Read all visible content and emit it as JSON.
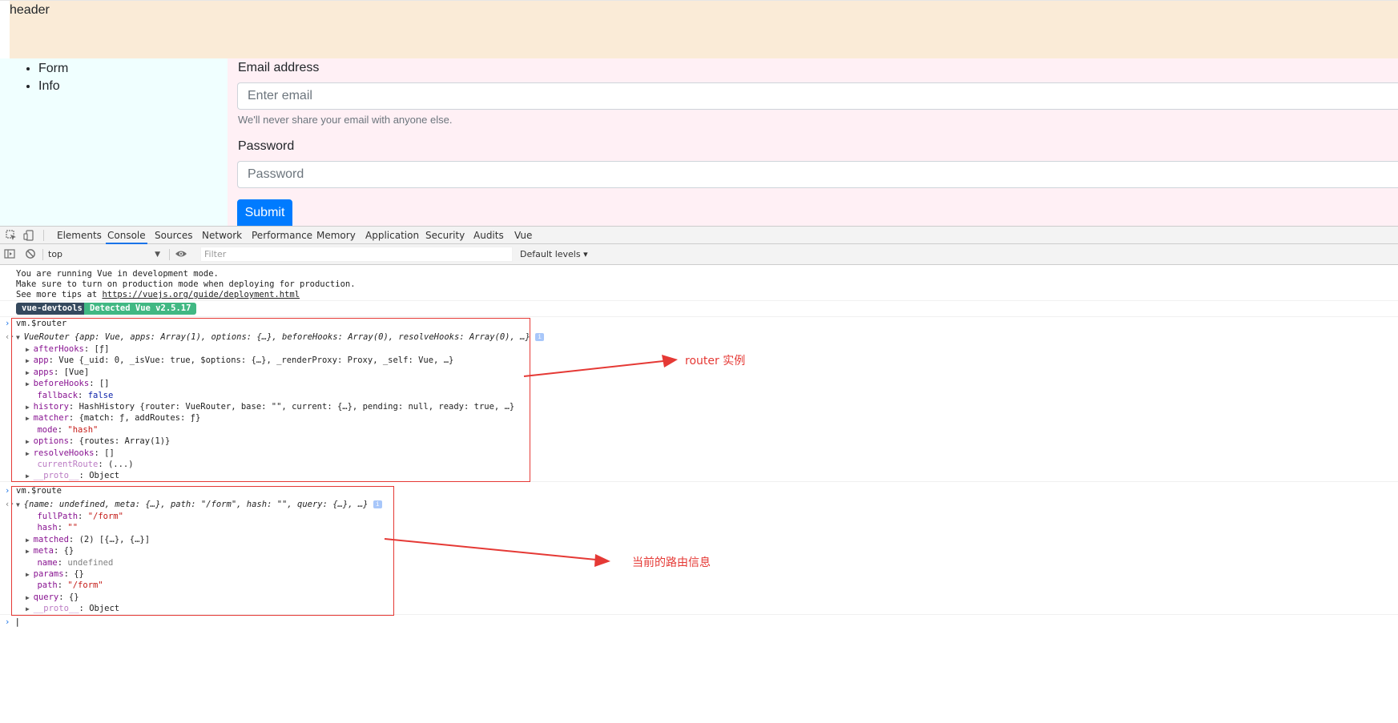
{
  "app": {
    "header_text": "header",
    "nav": [
      {
        "label": "Form"
      },
      {
        "label": "Info"
      }
    ],
    "form": {
      "email_label": "Email address",
      "email_placeholder": "Enter email",
      "email_help": "We'll never share your email with anyone else.",
      "password_label": "Password",
      "password_placeholder": "Password",
      "submit_label": "Submit"
    }
  },
  "devtools": {
    "tabs": [
      "Elements",
      "Console",
      "Sources",
      "Network",
      "Performance",
      "Memory",
      "Application",
      "Security",
      "Audits",
      "Vue"
    ],
    "active_tab": "Console",
    "context": "top",
    "filter_placeholder": "Filter",
    "levels_label": "Default levels ▾",
    "console": {
      "vue_dev_lines": [
        "You are running Vue in development mode.",
        "Make sure to turn on production mode when deploying for production."
      ],
      "tips_prefix": "See more tips at ",
      "tips_link": "https://vuejs.org/guide/deployment.html",
      "badge_left": "vue-devtools",
      "badge_right": "Detected Vue v2.5.17",
      "cmd_router": "vm.$router",
      "cmd_route": "vm.$route",
      "router_summary": "VueRouter {app: Vue, apps: Array(1), options: {…}, beforeHooks: Array(0), resolveHooks: Array(0), …}",
      "router_props": [
        {
          "key": "afterHooks",
          "value": "[ƒ]",
          "expandable": true
        },
        {
          "key": "app",
          "value": "Vue {_uid: 0, _isVue: true, $options: {…}, _renderProxy: Proxy, _self: Vue, …}",
          "expandable": true
        },
        {
          "key": "apps",
          "value": "[Vue]",
          "expandable": true
        },
        {
          "key": "beforeHooks",
          "value": "[]",
          "expandable": true
        },
        {
          "key": "fallback",
          "value": "false",
          "expandable": false
        },
        {
          "key": "history",
          "value": "HashHistory {router: VueRouter, base: \"\", current: {…}, pending: null, ready: true, …}",
          "expandable": true
        },
        {
          "key": "matcher",
          "value": "{match: ƒ, addRoutes: ƒ}",
          "expandable": true
        },
        {
          "key": "mode",
          "value": "\"hash\"",
          "expandable": false
        },
        {
          "key": "options",
          "value": "{routes: Array(1)}",
          "expandable": true
        },
        {
          "key": "resolveHooks",
          "value": "[]",
          "expandable": true
        },
        {
          "key": "currentRoute",
          "value": "(...)",
          "expandable": false
        },
        {
          "key": "__proto__",
          "value": "Object",
          "expandable": true
        }
      ],
      "route_summary": "{name: undefined, meta: {…}, path: \"/form\", hash: \"\", query: {…}, …}",
      "route_props": [
        {
          "key": "fullPath",
          "value": "\"/form\"",
          "expandable": false
        },
        {
          "key": "hash",
          "value": "\"\"",
          "expandable": false
        },
        {
          "key": "matched",
          "value": "(2) [{…}, {…}]",
          "expandable": true
        },
        {
          "key": "meta",
          "value": "{}",
          "expandable": true
        },
        {
          "key": "name",
          "value": "undefined",
          "expandable": false
        },
        {
          "key": "params",
          "value": "{}",
          "expandable": true
        },
        {
          "key": "path",
          "value": "\"/form\"",
          "expandable": false
        },
        {
          "key": "query",
          "value": "{}",
          "expandable": true
        },
        {
          "key": "__proto__",
          "value": "Object",
          "expandable": true
        }
      ]
    }
  },
  "annotations": {
    "router": "router 实例",
    "route": "当前的路由信息",
    "color": "#e53935"
  }
}
